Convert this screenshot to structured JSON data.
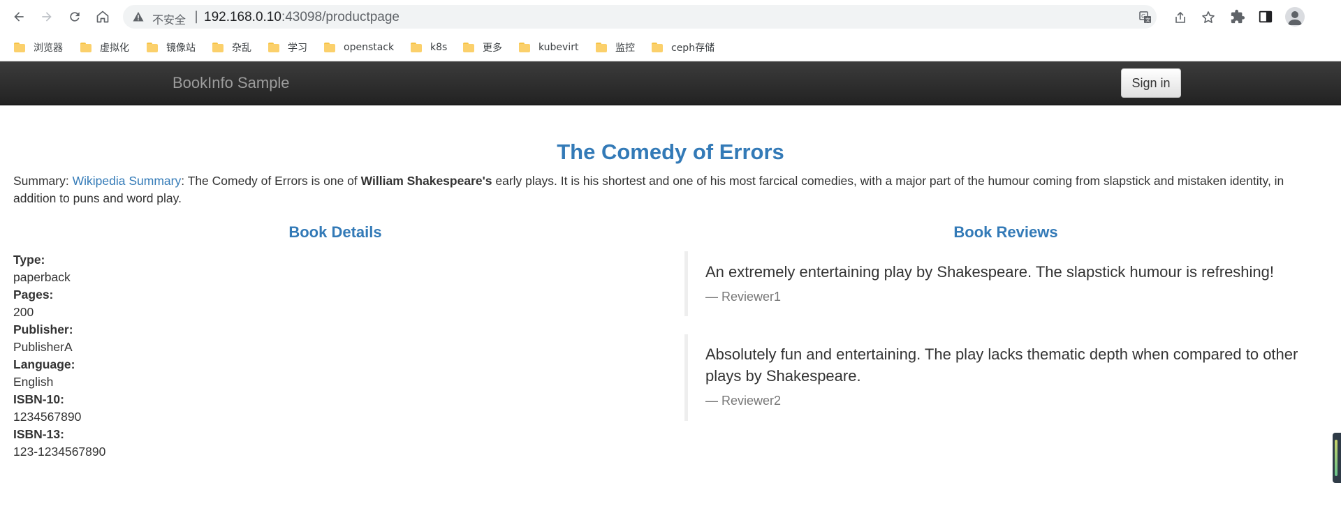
{
  "browser": {
    "security_label": "不安全",
    "separator": "|",
    "url_host": "192.168.0.10",
    "url_rest": ":43098/productpage",
    "bookmarks": [
      "浏览器",
      "虚拟化",
      "镜像站",
      "杂乱",
      "学习",
      "openstack",
      "k8s",
      "更多",
      "kubevirt",
      "监控",
      "ceph存储"
    ]
  },
  "navbar": {
    "brand": "BookInfo Sample",
    "signin_label": "Sign in"
  },
  "book": {
    "title": "The Comedy of Errors",
    "summary_prefix": "Summary: ",
    "summary_link": "Wikipedia Summary",
    "summary_text_1": ": The Comedy of Errors is one of ",
    "summary_bold": "William Shakespeare's",
    "summary_text_2": " early plays. It is his shortest and one of his most farcical comedies, with a major part of the humour coming from slapstick and mistaken identity, in addition to puns and word play."
  },
  "details": {
    "heading": "Book Details",
    "type_label": "Type:",
    "type_value": "paperback",
    "pages_label": "Pages:",
    "pages_value": "200",
    "publisher_label": "Publisher:",
    "publisher_value": "PublisherA",
    "language_label": "Language:",
    "language_value": "English",
    "isbn10_label": "ISBN-10:",
    "isbn10_value": "1234567890",
    "isbn13_label": "ISBN-13:",
    "isbn13_value": "123-1234567890"
  },
  "reviews": {
    "heading": "Book Reviews",
    "items": [
      {
        "text": "An extremely entertaining play by Shakespeare. The slapstick humour is refreshing!",
        "reviewer": "Reviewer1"
      },
      {
        "text": "Absolutely fun and entertaining. The play lacks thematic depth when compared to other plays by Shakespeare.",
        "reviewer": "Reviewer2"
      }
    ]
  },
  "colors": {
    "link": "#337ab7",
    "navbar_bg": "#222222",
    "brand": "#9d9d9d"
  }
}
